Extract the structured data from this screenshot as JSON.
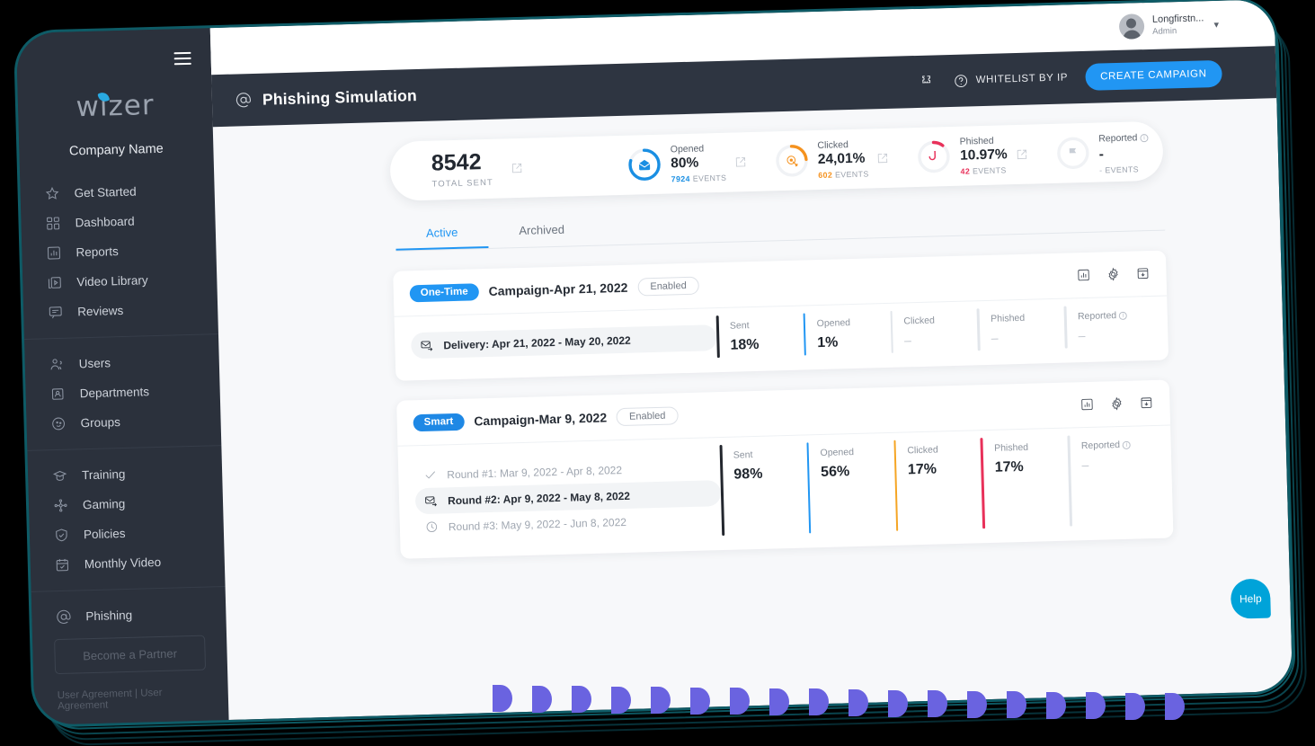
{
  "sidebar": {
    "logo_text": "wizer",
    "company": "Company Name",
    "groups": [
      {
        "items": [
          {
            "label": "Get Started",
            "icon": "star-icon"
          },
          {
            "label": "Dashboard",
            "icon": "dashboard-grid-icon"
          },
          {
            "label": "Reports",
            "icon": "chart-bar-icon"
          },
          {
            "label": "Video Library",
            "icon": "video-play-icon"
          },
          {
            "label": "Reviews",
            "icon": "comment-icon"
          }
        ]
      },
      {
        "items": [
          {
            "label": "Users",
            "icon": "users-icon"
          },
          {
            "label": "Departments",
            "icon": "id-card-icon"
          },
          {
            "label": "Groups",
            "icon": "group-circle-icon"
          }
        ]
      },
      {
        "items": [
          {
            "label": "Training",
            "icon": "graduation-cap-icon"
          },
          {
            "label": "Gaming",
            "icon": "gamepad-icon"
          },
          {
            "label": "Policies",
            "icon": "shield-check-icon"
          },
          {
            "label": "Monthly Video",
            "icon": "calendar-check-icon"
          }
        ]
      },
      {
        "items": [
          {
            "label": "Phishing",
            "icon": "at-sign-icon"
          }
        ]
      }
    ],
    "partner_button": "Become a Partner",
    "agreement": "User Agreement | User Agreement"
  },
  "topbar": {
    "user_name": "Longfirstn...",
    "user_role": "Admin",
    "chevron": "⌄"
  },
  "pagebar": {
    "title": "Phishing Simulation",
    "whitelist_label": "WHITELIST BY IP",
    "cta_label": "CREATE CAMPAIGN"
  },
  "stats": {
    "total": {
      "value": "8542",
      "label": "TOTAL SENT"
    },
    "items": [
      {
        "name": "Opened",
        "value": "80%",
        "events": "7924",
        "events_label": "EVENTS",
        "color": "#1a8fe3",
        "percent": 80,
        "icon": "opened-envelope-icon"
      },
      {
        "name": "Clicked",
        "value": "24,01%",
        "events": "602",
        "events_label": "EVENTS",
        "color": "#f5921e",
        "percent": 24,
        "icon": "click-target-icon"
      },
      {
        "name": "Phished",
        "value": "10.97%",
        "events": "42",
        "events_label": "EVENTS",
        "color": "#e8315a",
        "percent": 11,
        "icon": "fish-hook-icon"
      },
      {
        "name": "Reported",
        "value": "-",
        "events": "-",
        "events_label": "EVENTS",
        "color": "#c8ced6",
        "percent": 0,
        "icon": "flag-icon",
        "has_info": true
      }
    ]
  },
  "tabs": [
    {
      "label": "Active",
      "active": true
    },
    {
      "label": "Archived",
      "active": false
    }
  ],
  "campaigns": [
    {
      "type_badge": "One-Time",
      "badge_class": "one-time",
      "name": "Campaign-Apr 21, 2022",
      "status": "Enabled",
      "actions": [
        "stats-bar-icon",
        "gear-icon",
        "archive-box-icon"
      ],
      "rounds": [
        {
          "label": "Delivery: Apr 21, 2022 - May 20, 2022",
          "icon": "envelope-send-icon",
          "state": "active"
        }
      ],
      "metrics": [
        {
          "name": "Sent",
          "value": "18%",
          "color_class": "c-dark"
        },
        {
          "name": "Opened",
          "value": "1%",
          "color_class": "c-blue"
        },
        {
          "name": "Clicked",
          "value": "–",
          "color_class": "c-grey",
          "dash": true
        },
        {
          "name": "Phished",
          "value": "–",
          "color_class": "c-grey",
          "dash": true
        },
        {
          "name": "Reported",
          "value": "–",
          "color_class": "c-grey",
          "dash": true,
          "has_info": true
        }
      ]
    },
    {
      "type_badge": "Smart",
      "badge_class": "smart",
      "name": "Campaign-Mar 9, 2022",
      "status": "Enabled",
      "actions": [
        "stats-bar-icon",
        "gear-icon",
        "archive-box-icon"
      ],
      "rounds": [
        {
          "label": "Round #1: Mar 9, 2022 - Apr 8, 2022",
          "icon": "check-icon",
          "state": "done"
        },
        {
          "label": "Round #2: Apr 9, 2022 - May 8, 2022",
          "icon": "envelope-send-icon",
          "state": "active"
        },
        {
          "label": "Round #3: May 9, 2022 - Jun 8, 2022",
          "icon": "clock-icon",
          "state": "pending"
        }
      ],
      "metrics": [
        {
          "name": "Sent",
          "value": "98%",
          "color_class": "c-dark"
        },
        {
          "name": "Opened",
          "value": "56%",
          "color_class": "c-blue"
        },
        {
          "name": "Clicked",
          "value": "17%",
          "color_class": "c-orange"
        },
        {
          "name": "Phished",
          "value": "17%",
          "color_class": "c-red"
        },
        {
          "name": "Reported",
          "value": "–",
          "color_class": "c-grey",
          "dash": true,
          "has_info": true
        }
      ]
    }
  ],
  "help": {
    "label": "Help"
  },
  "colors": {
    "accent_blue": "#2196f3",
    "sidebar_bg": "#2b313c",
    "pagebar_bg": "#2e3541",
    "orange": "#f5921e",
    "red": "#e8315a",
    "deco_purple": "#6a63e0",
    "frame_teal": "#0e5b66"
  }
}
